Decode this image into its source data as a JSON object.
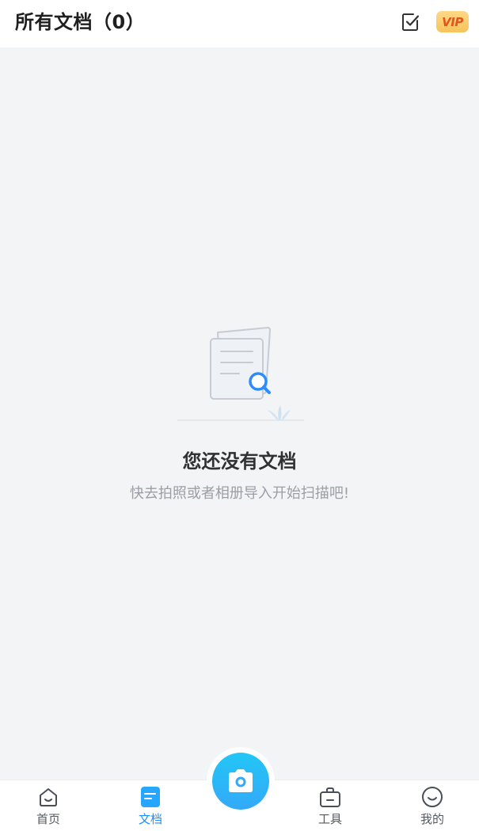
{
  "header": {
    "title": "所有文档（0）",
    "select_icon": "checkbox-select-icon",
    "vip_label": "VIP",
    "vip_colors": {
      "from": "#ffd886",
      "to": "#f6c45c",
      "text": "#e0561b"
    }
  },
  "empty_state": {
    "illustration": "document-search-illustration",
    "title": "您还没有文档",
    "subtitle": "快去拍照或者相册导入开始扫描吧!"
  },
  "bottom_nav": {
    "items": [
      {
        "label": "首页",
        "icon": "home-icon",
        "active": false
      },
      {
        "label": "文档",
        "icon": "document-icon",
        "active": true
      },
      {
        "label": "工具",
        "icon": "toolbox-icon",
        "active": false
      },
      {
        "label": "我的",
        "icon": "profile-icon",
        "active": false
      }
    ],
    "camera_icon": "camera-icon",
    "accent_color": "#1f8cff"
  }
}
